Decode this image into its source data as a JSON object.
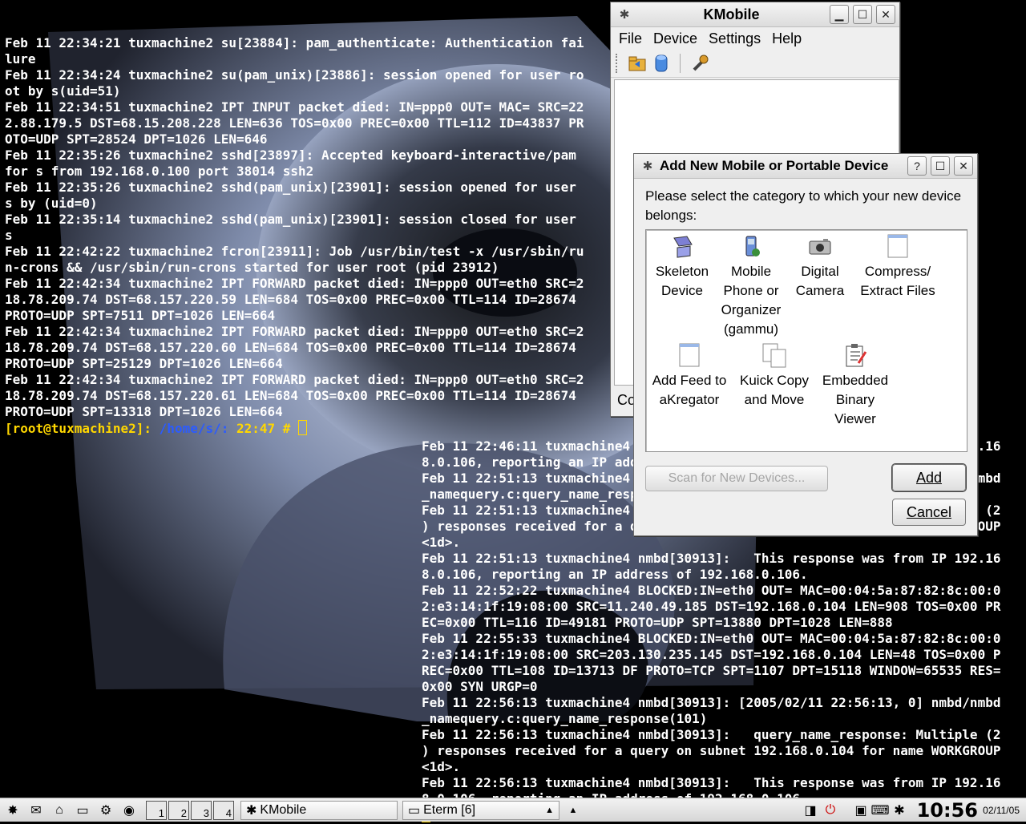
{
  "terminal1": {
    "lines": [
      "Feb 11 22:34:21 tuxmachine2 su[23884]: pam_authenticate: Authentication fai",
      "lure",
      "Feb 11 22:34:24 tuxmachine2 su(pam_unix)[23886]: session opened for user ro",
      "ot by s(uid=51)",
      "Feb 11 22:34:51 tuxmachine2 IPT INPUT packet died: IN=ppp0 OUT= MAC= SRC=22",
      "2.88.179.5 DST=68.15.208.228 LEN=636 TOS=0x00 PREC=0x00 TTL=112 ID=43837 PR",
      "OTO=UDP SPT=28524 DPT=1026 LEN=646",
      "Feb 11 22:35:26 tuxmachine2 sshd[23897]: Accepted keyboard-interactive/pam",
      "for s from 192.168.0.100 port 38014 ssh2",
      "Feb 11 22:35:26 tuxmachine2 sshd(pam_unix)[23901]: session opened for user",
      "s by (uid=0)",
      "Feb 11 22:35:14 tuxmachine2 sshd(pam_unix)[23901]: session closed for user",
      "s",
      "Feb 11 22:42:22 tuxmachine2 fcron[23911]: Job /usr/bin/test -x /usr/sbin/ru",
      "n-crons && /usr/sbin/run-crons started for user root (pid 23912)",
      "Feb 11 22:42:34 tuxmachine2 IPT FORWARD packet died: IN=ppp0 OUT=eth0 SRC=2",
      "18.78.209.74 DST=68.157.220.59 LEN=684 TOS=0x00 PREC=0x00 TTL=114 ID=28674",
      "PROTO=UDP SPT=7511 DPT=1026 LEN=664",
      "Feb 11 22:42:34 tuxmachine2 IPT FORWARD packet died: IN=ppp0 OUT=eth0 SRC=2",
      "18.78.209.74 DST=68.157.220.60 LEN=684 TOS=0x00 PREC=0x00 TTL=114 ID=28674",
      "PROTO=UDP SPT=25129 DPT=1026 LEN=664",
      "Feb 11 22:42:34 tuxmachine2 IPT FORWARD packet died: IN=ppp0 OUT=eth0 SRC=2",
      "18.78.209.74 DST=68.157.220.61 LEN=684 TOS=0x00 PREC=0x00 TTL=114 ID=28674",
      "PROTO=UDP SPT=13318 DPT=1026 LEN=664"
    ],
    "prompt_user": "[root@tuxmachine2]:",
    "prompt_path": "/home/s/:",
    "prompt_rest": " 22:47 # "
  },
  "terminal2": {
    "lines": [
      "Feb 11 22:46:11 tuxmachine4 nmbd[30913]:   This response was from IP 192.16",
      "8.0.106, reporting an IP address of 192.168.0.106.",
      "Feb 11 22:51:13 tuxmachine4 nmbd[30913]: [2005/02/11 22:51:13, 0] nmbd/nmbd",
      "_namequery.c:query_name_response(101)",
      "Feb 11 22:51:13 tuxmachine4 nmbd[30913]:   query_name_response: Multiple (2",
      ") responses received for a query on subnet 192.168.0.104 for name WORKGROUP",
      "<1d>.",
      "Feb 11 22:51:13 tuxmachine4 nmbd[30913]:   This response was from IP 192.16",
      "8.0.106, reporting an IP address of 192.168.0.106.",
      "Feb 11 22:52:22 tuxmachine4 BLOCKED:IN=eth0 OUT= MAC=00:04:5a:87:82:8c:00:0",
      "2:e3:14:1f:19:08:00 SRC=11.240.49.185 DST=192.168.0.104 LEN=908 TOS=0x00 PR",
      "EC=0x00 TTL=116 ID=49181 PROTO=UDP SPT=13880 DPT=1028 LEN=888",
      "Feb 11 22:55:33 tuxmachine4 BLOCKED:IN=eth0 OUT= MAC=00:04:5a:87:82:8c:00:0",
      "2:e3:14:1f:19:08:00 SRC=203.130.235.145 DST=192.168.0.104 LEN=48 TOS=0x00 P",
      "REC=0x00 TTL=108 ID=13713 DF PROTO=TCP SPT=1107 DPT=15118 WINDOW=65535 RES=",
      "0x00 SYN URGP=0",
      "Feb 11 22:56:13 tuxmachine4 nmbd[30913]: [2005/02/11 22:56:13, 0] nmbd/nmbd",
      "_namequery.c:query_name_response(101)",
      "Feb 11 22:56:13 tuxmachine4 nmbd[30913]:   query_name_response: Multiple (2",
      ") responses received for a query on subnet 192.168.0.104 for name WORKGROUP",
      "<1d>.",
      "Feb 11 22:56:13 tuxmachine4 nmbd[30913]:   This response was from IP 192.16",
      "8.0.106, reporting an IP address of 192.168.0.106."
    ]
  },
  "kmobile": {
    "title": "KMobile",
    "menu": [
      "File",
      "Device",
      "Settings",
      "Help"
    ],
    "status_fragment": "Co"
  },
  "dialog": {
    "title": "Add New Mobile or Portable Device",
    "prompt": "Please select the category to which your new device belongs:",
    "items": [
      {
        "label": "Skeleton\nDevice",
        "icon": "skeleton-device-icon"
      },
      {
        "label": "Mobile\nPhone or\nOrganizer\n(gammu)",
        "icon": "mobile-phone-icon"
      },
      {
        "label": "Digital\nCamera",
        "icon": "camera-icon"
      },
      {
        "label": "Compress/\nExtract Files",
        "icon": "document-icon"
      },
      {
        "label": "Add Feed to\naKregator",
        "icon": "document-icon"
      },
      {
        "label": "Kuick Copy\nand Move",
        "icon": "copy-icon"
      },
      {
        "label": "Embedded\nBinary\nViewer",
        "icon": "clipboard-edit-icon"
      }
    ],
    "scan_label": "Scan for New Devices...",
    "add_label": "Add",
    "cancel_label": "Cancel"
  },
  "taskbar": {
    "pager": [
      "1",
      "2",
      "3",
      "4"
    ],
    "tasks": [
      "KMobile",
      "Eterm [6]"
    ],
    "clock": "10:56",
    "date": "02/11/05"
  }
}
